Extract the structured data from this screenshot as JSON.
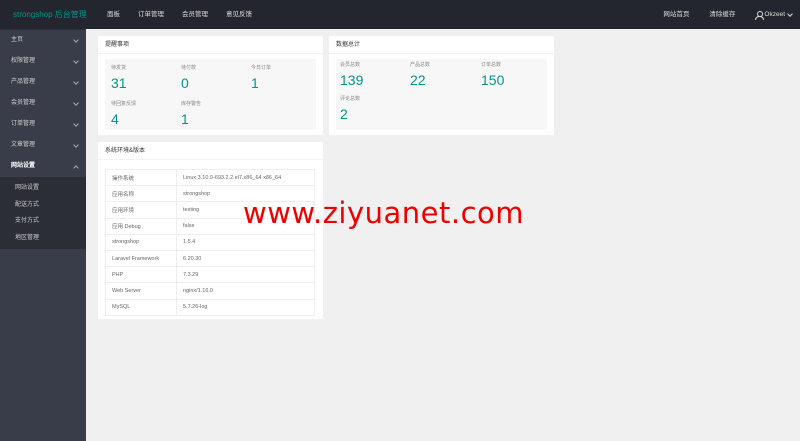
{
  "brand": "strongshop 后台管理",
  "topnav": [
    "面板",
    "订单管理",
    "会员管理",
    "意见反馈"
  ],
  "topright": {
    "site_home": "网站首页",
    "clear_cache": "清除缓存",
    "user": "Okzeet"
  },
  "sidebar": {
    "items": [
      {
        "label": "主页"
      },
      {
        "label": "权限管理"
      },
      {
        "label": "产品管理"
      },
      {
        "label": "会员管理"
      },
      {
        "label": "订单管理"
      },
      {
        "label": "文章管理"
      },
      {
        "label": "网站设置"
      }
    ],
    "sub_items": [
      "网站设置",
      "配送方式",
      "支付方式",
      "地区管理"
    ]
  },
  "reminders": {
    "title": "提醒事项",
    "stats": [
      {
        "label": "待发货",
        "value": "31"
      },
      {
        "label": "待付款",
        "value": "0"
      },
      {
        "label": "今日订单",
        "value": "1"
      },
      {
        "label": "待回复反馈",
        "value": "4"
      },
      {
        "label": "库存警告",
        "value": "1"
      }
    ]
  },
  "summary": {
    "title": "数据总计",
    "stats": [
      {
        "label": "会员总数",
        "value": "139"
      },
      {
        "label": "产品总数",
        "value": "22"
      },
      {
        "label": "订单总数",
        "value": "150"
      },
      {
        "label": "评论总数",
        "value": "2"
      }
    ]
  },
  "env": {
    "title": "系统环境&版本",
    "rows": [
      {
        "k": "操作系统",
        "v": "Linux 3.10.0-693.2.2.el7.x86_64 x86_64"
      },
      {
        "k": "应用名称",
        "v": "strongshop"
      },
      {
        "k": "应用环境",
        "v": "testing"
      },
      {
        "k": "应用 Debug",
        "v": "false"
      },
      {
        "k": "strongshop",
        "v": "1.5.4"
      },
      {
        "k": "Laravel Framework",
        "v": "6.20.30"
      },
      {
        "k": "PHP",
        "v": "7.3.29"
      },
      {
        "k": "Web Server",
        "v": "nginx/1.16.0"
      },
      {
        "k": "MySQL",
        "v": "5.7.26-log"
      }
    ]
  },
  "watermark": "www.ziyuanet.com"
}
